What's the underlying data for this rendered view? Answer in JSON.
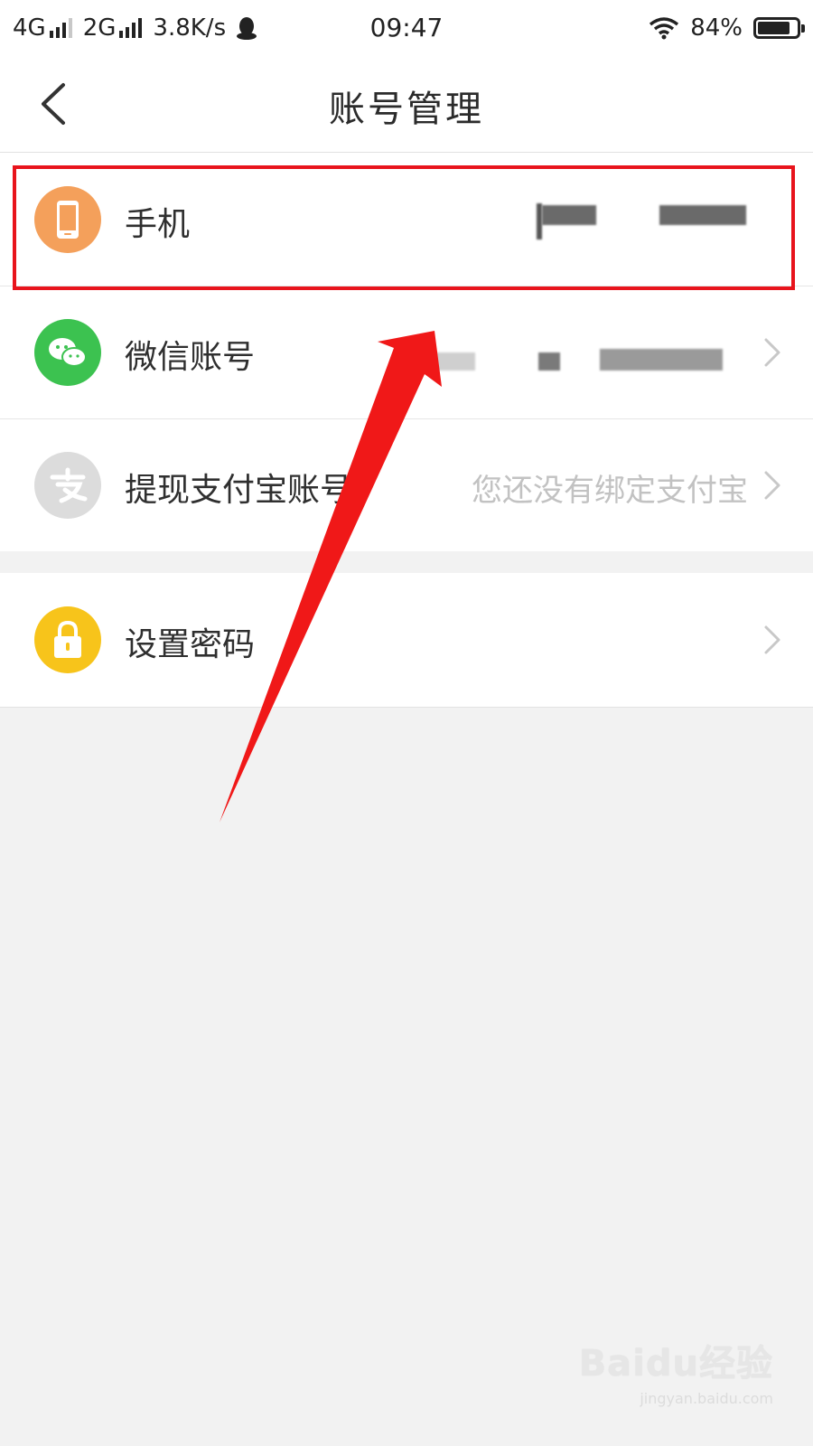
{
  "status_bar": {
    "network_1": "4G",
    "network_2": "2G",
    "speed": "3.8K/s",
    "time": "09:47",
    "battery_percent": "84%",
    "battery_level": 0.84,
    "icons": [
      "signal-icon",
      "qq-penguin-icon",
      "wifi-icon",
      "battery-icon"
    ]
  },
  "header": {
    "title": "账号管理",
    "back_icon": "chevron-left-icon"
  },
  "rows": [
    {
      "label": "手机",
      "icon": "phone-icon",
      "icon_color": "#f4a05b",
      "value": ""
    },
    {
      "label": "微信账号",
      "icon": "wechat-icon",
      "icon_color": "#3cc250",
      "value": ""
    },
    {
      "label": "提现支付宝账号",
      "icon": "alipay-icon",
      "icon_color": "#dcdcdc",
      "value": "您还没有绑定支付宝"
    },
    {
      "label": "设置密码",
      "icon": "lock-icon",
      "icon_color": "#f7c41b",
      "value": ""
    }
  ],
  "annotation": {
    "highlight_color": "#e8141c"
  },
  "watermark": {
    "brand": "Baidu经验",
    "url": "jingyan.baidu.com"
  },
  "colors": {
    "page_background": "#f2f2f2",
    "panel": "#ffffff",
    "muted_text": "#c2c2c2"
  }
}
